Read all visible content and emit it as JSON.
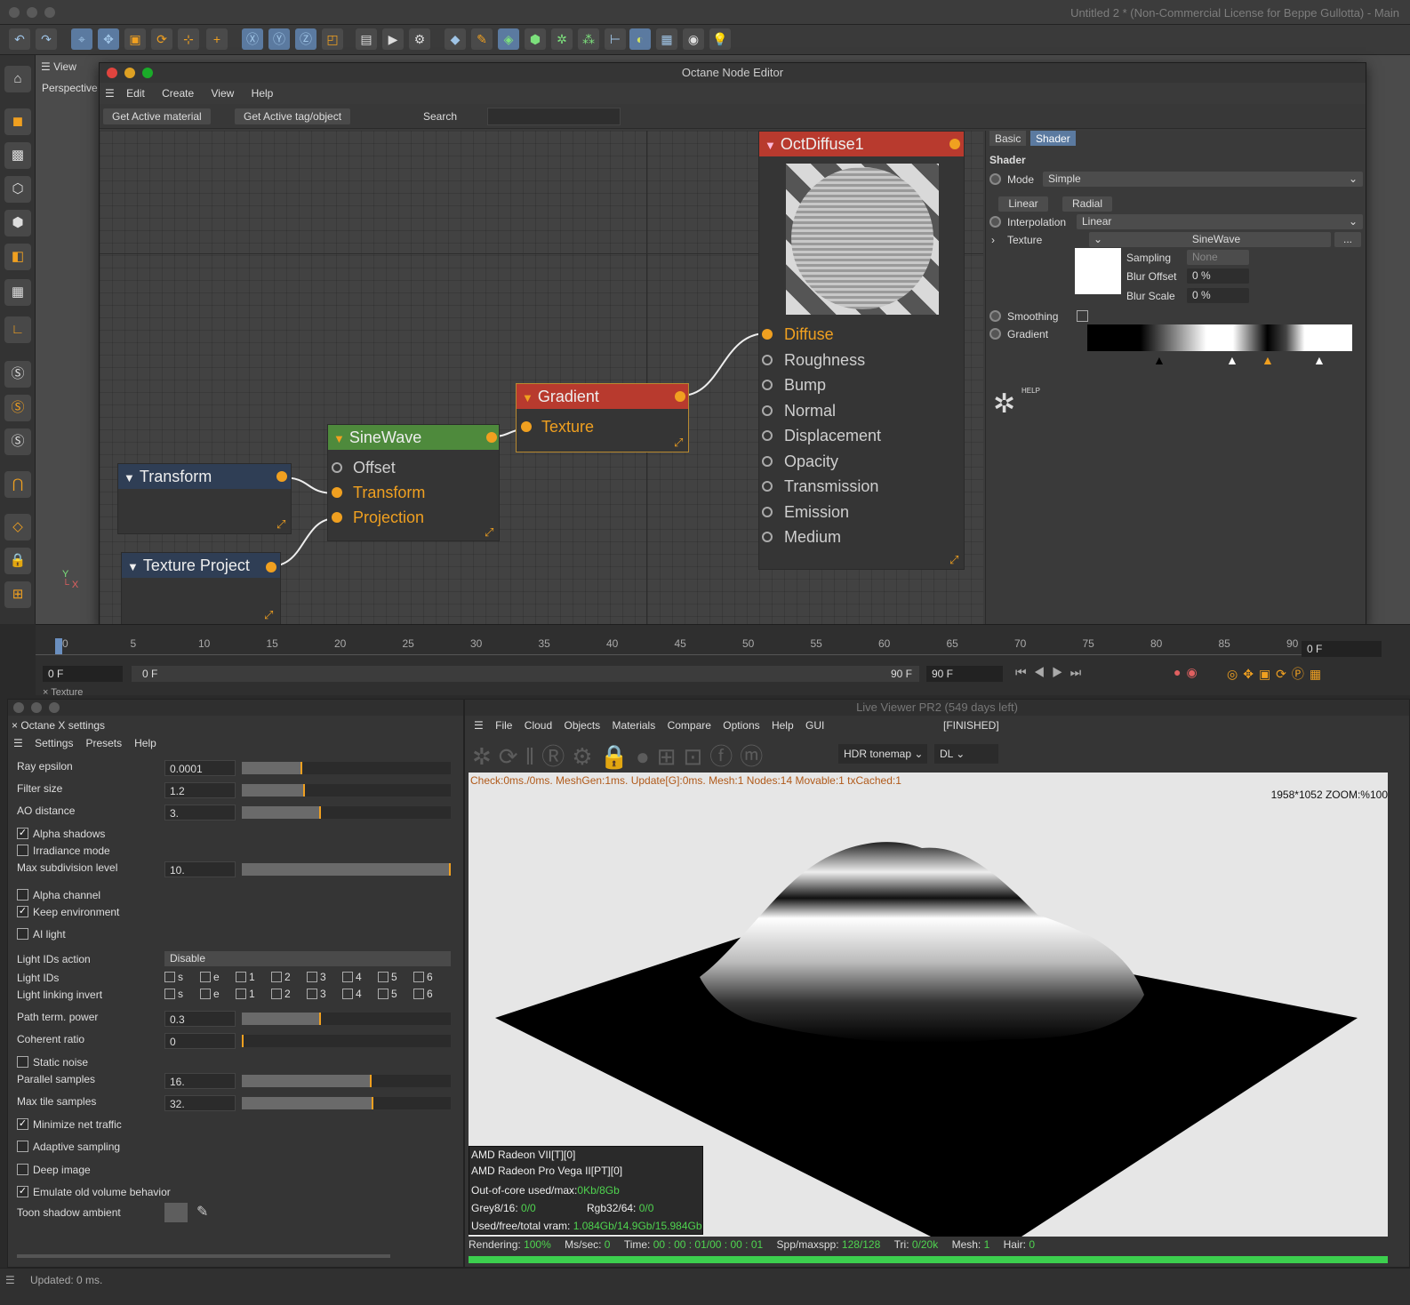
{
  "app": {
    "window_title": "Untitled 2 * (Non-Commercial License for Beppe Gullotta) - Main"
  },
  "viewport": {
    "menu_label": "View",
    "camera_label": "Perspective"
  },
  "node_editor": {
    "title": "Octane Node Editor",
    "menu": [
      "Edit",
      "Create",
      "View",
      "Help"
    ],
    "buttons": {
      "active_material": "Get Active material",
      "active_tag": "Get Active tag/object",
      "search_label": "Search"
    },
    "nodes": {
      "diffuse": {
        "title": "OctDiffuse1",
        "pins": [
          "Diffuse",
          "Roughness",
          "Bump",
          "Normal",
          "Displacement",
          "Opacity",
          "Transmission",
          "Emission",
          "Medium"
        ]
      },
      "gradient": {
        "title": "Gradient",
        "pins": [
          "Texture"
        ]
      },
      "sinewave": {
        "title": "SineWave",
        "pins": [
          "Offset",
          "Transform",
          "Projection"
        ]
      },
      "transform": {
        "title": "Transform"
      },
      "texture_project": {
        "title": "Texture Project"
      }
    },
    "props": {
      "tabs": [
        "Basic",
        "Shader"
      ],
      "section": "Shader",
      "mode_label": "Mode",
      "mode_value": "Simple",
      "linear_btn": "Linear",
      "radial_btn": "Radial",
      "interp_label": "Interpolation",
      "interp_value": "Linear",
      "texture_label": "Texture",
      "texture_value": "SineWave",
      "texture_more": "...",
      "sampling_label": "Sampling",
      "sampling_value": "None",
      "blur_offset_label": "Blur Offset",
      "blur_offset_value": "0 %",
      "blur_scale_label": "Blur Scale",
      "blur_scale_value": "0 %",
      "smoothing_label": "Smoothing",
      "gradient_label": "Gradient",
      "help_label": "HELP"
    }
  },
  "timeline": {
    "ticks": [
      "0",
      "5",
      "10",
      "15",
      "20",
      "25",
      "30",
      "35",
      "40",
      "45",
      "50",
      "55",
      "60",
      "65",
      "70",
      "75",
      "80",
      "85",
      "90"
    ],
    "current_frame": "0 F",
    "start": "0 F",
    "mid": "0 F",
    "end": "90 F",
    "end2": "90 F",
    "right_field": "0 F",
    "texture_tab": "Texture"
  },
  "settings": {
    "title": "Octane X settings",
    "menu": [
      "Settings",
      "Presets",
      "Help"
    ],
    "rows": {
      "ray_epsilon": {
        "label": "Ray epsilon",
        "value": "0.0001",
        "fill": 0.29
      },
      "filter_size": {
        "label": "Filter size",
        "value": "1.2",
        "fill": 0.3
      },
      "ao_distance": {
        "label": "AO distance",
        "value": "3.",
        "fill": 0.38
      },
      "max_subdiv": {
        "label": "Max subdivision level",
        "value": "10.",
        "fill": 1.0
      },
      "path_term": {
        "label": "Path term. power",
        "value": "0.3",
        "fill": 0.38
      },
      "coherent": {
        "label": "Coherent ratio",
        "value": "0",
        "fill": 0.0
      },
      "parallel": {
        "label": "Parallel samples",
        "value": "16.",
        "fill": 0.62
      },
      "max_tile": {
        "label": "Max tile samples",
        "value": "32.",
        "fill": 0.63
      }
    },
    "checks": {
      "alpha_shadows": "Alpha shadows",
      "irradiance": "Irradiance mode",
      "alpha_channel": "Alpha channel",
      "keep_env": "Keep environment",
      "ai_light": "AI light",
      "static_noise": "Static noise",
      "min_net": "Minimize net traffic",
      "adaptive": "Adaptive sampling",
      "deep_image": "Deep image",
      "emulate_vol": "Emulate old volume behavior"
    },
    "light_ids_action_label": "Light IDs action",
    "light_ids_action_value": "Disable",
    "light_ids_label": "Light IDs",
    "light_link_label": "Light linking invert",
    "light_id_opts": [
      "s",
      "e",
      "1",
      "2",
      "3",
      "4",
      "5",
      "6"
    ],
    "toon_label": "Toon shadow ambient"
  },
  "live_viewer": {
    "title": "Live Viewer PR2 (549 days left)",
    "menu": [
      "File",
      "Cloud",
      "Objects",
      "Materials",
      "Compare",
      "Options",
      "Help",
      "GUI"
    ],
    "status": "[FINISHED]",
    "tonemap": "HDR tonemap",
    "channel": "DL",
    "stats_line": "Check:0ms./0ms. MeshGen:1ms. Update[G]:0ms. Mesh:1 Nodes:14 Movable:1 txCached:1",
    "resolution": "1958*1052 ZOOM:%100",
    "gpu1": "AMD Radeon VII[T][0]",
    "gpu2": "AMD Radeon Pro Vega II[PT][0]",
    "ooc_label": "Out-of-core used/max:",
    "ooc_value": "0Kb/8Gb",
    "grey_label": "Grey8/16:",
    "grey_value": "0/0",
    "rgb_label": "Rgb32/64:",
    "rgb_value": "0/0",
    "vram_label": "Used/free/total vram:",
    "vram_value": "1.084Gb/14.9Gb/15.984Gb",
    "rendering_label": "Rendering:",
    "rendering_value": "100%",
    "ms_label": "Ms/sec:",
    "ms_value": "0",
    "time_label": "Time:",
    "time_value": "00 : 00 : 01/00 : 00 : 01",
    "spp_label": "Spp/maxspp:",
    "spp_value": "128/128",
    "tri_label": "Tri:",
    "tri_value": "0/20k",
    "mesh_label": "Mesh:",
    "mesh_value": "1",
    "hair_label": "Hair:",
    "hair_value": "0",
    "progress": 1.0
  },
  "statusbar": {
    "text": "Updated: 0 ms."
  },
  "colors": {
    "accent": "#f0a020",
    "node_red": "#b83a2e",
    "node_green": "#4e8a3c",
    "link": "#9fc4e6"
  }
}
